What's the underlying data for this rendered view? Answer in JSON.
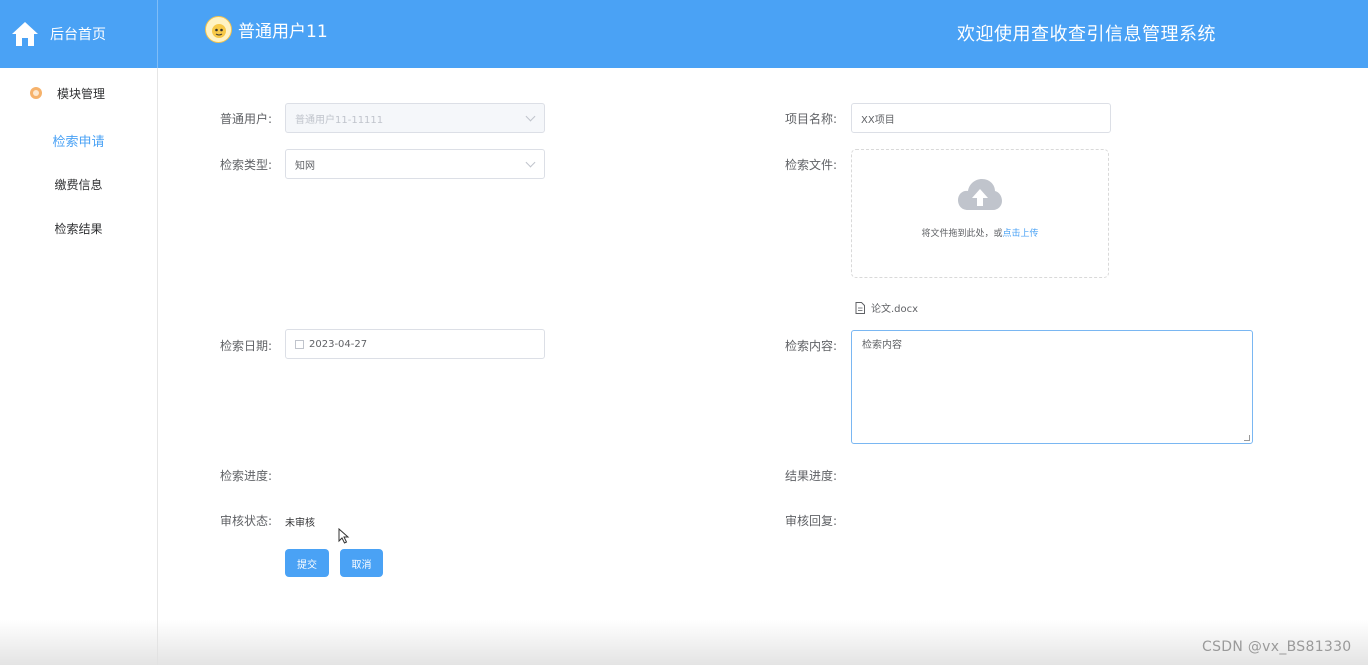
{
  "header": {
    "home_label": "后台首页",
    "user_name": "普通用户11",
    "system_title": "欢迎使用查收查引信息管理系统"
  },
  "sidebar": {
    "parent_label": "模块管理",
    "items": [
      {
        "label": "检索申请",
        "active": true
      },
      {
        "label": "缴费信息",
        "active": false
      },
      {
        "label": "检索结果",
        "active": false
      }
    ]
  },
  "form": {
    "user_label": "普通用户:",
    "user_value": "普通用户11-11111",
    "project_label": "项目名称:",
    "project_value": "XX项目",
    "type_label": "检索类型:",
    "type_value": "知网",
    "file_label": "检索文件:",
    "upload_text": "将文件拖到此处，或",
    "upload_link": "点击上传",
    "file_name": "论文.docx",
    "date_label": "检索日期:",
    "date_value": "2023-04-27",
    "content_label": "检索内容:",
    "content_value": "检索内容",
    "progress_label": "检索进度:",
    "result_progress_label": "结果进度:",
    "review_status_label": "审核状态:",
    "review_status_value": "未审核",
    "review_reply_label": "审核回复:",
    "submit_label": "提交",
    "cancel_label": "取消"
  },
  "watermark": "CSDN @vx_BS81330",
  "colors": {
    "header_bg": "#4aa2f5",
    "accent": "#4aa2f5",
    "menu_icon": "#f6b26b"
  }
}
